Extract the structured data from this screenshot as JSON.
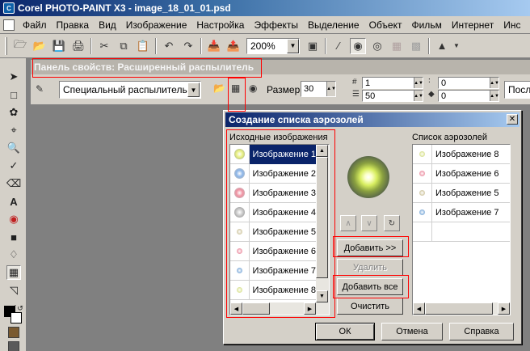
{
  "window": {
    "title": "Corel PHOTO-PAINT X3 - image_18_01_01.psd"
  },
  "menu": [
    "Файл",
    "Правка",
    "Вид",
    "Изображение",
    "Настройка",
    "Эффекты",
    "Выделение",
    "Объект",
    "Фильм",
    "Интернет",
    "Инс"
  ],
  "toolbar": {
    "zoom": "200%"
  },
  "property_bar": {
    "title": "Панель свойств: Расширенный распылитель",
    "sprayer": "Специальный распылитель",
    "size_label": "Размер",
    "size_value": "30",
    "count_value": "1",
    "rate_value": "50",
    "spread_value": "0",
    "offset_value": "0",
    "order_value": "Посл"
  },
  "dialog": {
    "title": "Создание списка аэрозолей",
    "source_label": "Исходные изображения",
    "source_items": [
      "Изображение 1",
      "Изображение 2",
      "Изображение 3",
      "Изображение 4",
      "Изображение 5",
      "Изображение 6",
      "Изображение 7",
      "Изображение 8"
    ],
    "sprayer_list_label": "Список аэрозолей",
    "sprayer_items": [
      "Изображение 8",
      "Изображение 6",
      "Изображение 5",
      "Изображение 7"
    ],
    "buttons": {
      "add": "Добавить >>",
      "remove": "Удалить",
      "add_all": "Добавить все",
      "clear": "Очистить",
      "ok": "ОК",
      "cancel": "Отмена",
      "help": "Справка"
    }
  },
  "colors": {
    "title_dark": "#0a246a",
    "title_light": "#a6caf0",
    "face": "#d4d0c8",
    "workspace": "#808080",
    "highlight": "#ff0000"
  }
}
